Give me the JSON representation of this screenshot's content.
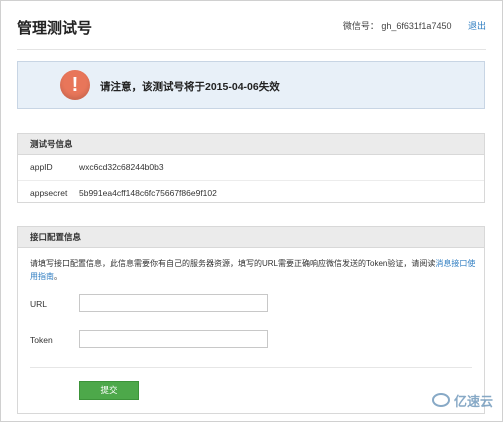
{
  "header": {
    "title": "管理测试号",
    "wechat_id_label": "微信号：",
    "wechat_id": "gh_6f631f1a7450",
    "logout": "退出"
  },
  "notice": {
    "icon": "exclamation-icon",
    "text": "请注意，该测试号将于2015-04-06失效"
  },
  "account_info": {
    "title": "测试号信息",
    "rows": [
      {
        "key": "appID",
        "value": "wxc6cd32c68244b0b3"
      },
      {
        "key": "appsecret",
        "value": "5b991ea4cff148c6fc75667f86e9f102"
      }
    ]
  },
  "api_config": {
    "title": "接口配置信息",
    "description": "请填写接口配置信息，此信息需要你有自己的服务器资源，填写的URL需要正确响应微信发送的Token验证，请阅读",
    "link": "消息接口使用指南",
    "description_end": "。",
    "url_label": "URL",
    "url_value": "",
    "token_label": "Token",
    "token_value": "",
    "submit": "提交"
  },
  "watermark": {
    "text": "亿速云",
    "icon": "cloud-logo-icon"
  },
  "colors": {
    "notice_bg": "#e8f0f8",
    "notice_icon": "#e8765a",
    "submit_green": "#4da84a",
    "link_blue": "#2d7cc1"
  }
}
